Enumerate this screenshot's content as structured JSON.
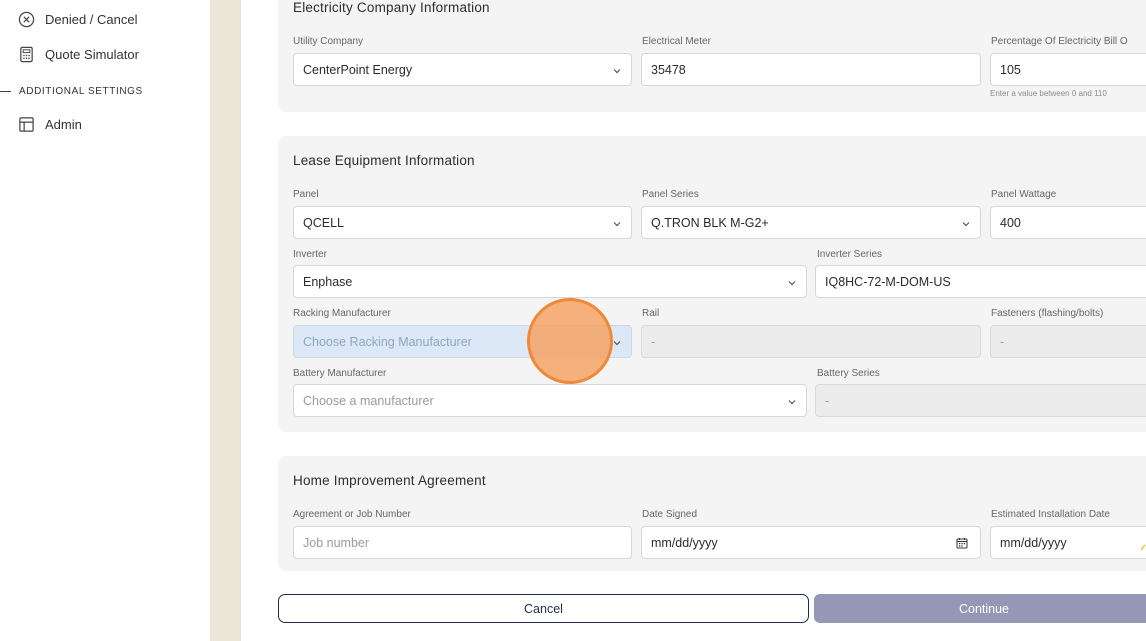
{
  "sidebar": {
    "items": [
      {
        "label": "Denied / Cancel",
        "icon": "circle-x-icon"
      },
      {
        "label": "Quote Simulator",
        "icon": "calculator-icon"
      }
    ],
    "section_label": "ADDITIONAL SETTINGS",
    "settings_items": [
      {
        "label": "Admin",
        "icon": "layout-icon"
      }
    ]
  },
  "electricity": {
    "title": "Electricity Company Information",
    "utility_company": {
      "label": "Utility Company",
      "value": "CenterPoint Energy"
    },
    "electrical_meter": {
      "label": "Electrical Meter",
      "value": "35478"
    },
    "bill_percentage": {
      "label": "Percentage Of Electricity Bill O",
      "value": "105",
      "hint": "Enter a value between 0 and 110"
    }
  },
  "lease": {
    "title": "Lease Equipment Information",
    "panel": {
      "label": "Panel",
      "value": "QCELL"
    },
    "panel_series": {
      "label": "Panel Series",
      "value": "Q.TRON BLK M-G2+"
    },
    "panel_wattage": {
      "label": "Panel Wattage",
      "value": "400"
    },
    "inverter": {
      "label": "Inverter",
      "value": "Enphase"
    },
    "inverter_series": {
      "label": "Inverter Series",
      "value": "IQ8HC-72-M-DOM-US"
    },
    "racking_manufacturer": {
      "label": "Racking Manufacturer",
      "placeholder": "Choose Racking Manufacturer"
    },
    "rail": {
      "label": "Rail",
      "value": "-"
    },
    "fasteners": {
      "label": "Fasteners (flashing/bolts)",
      "value": "-"
    },
    "battery_manufacturer": {
      "label": "Battery Manufacturer",
      "placeholder": "Choose a manufacturer"
    },
    "battery_series": {
      "label": "Battery Series",
      "value": "-"
    }
  },
  "agreement": {
    "title": "Home Improvement Agreement",
    "job_number": {
      "label": "Agreement or Job Number",
      "placeholder": "Job number"
    },
    "date_signed": {
      "label": "Date Signed",
      "value": "mm/dd/yyyy"
    },
    "install_date": {
      "label": "Estimated Installation Date",
      "value": "mm/dd/yyyy"
    }
  },
  "actions": {
    "cancel": "Cancel",
    "continue": "Continue"
  },
  "colors": {
    "primary_navy": "#1f2d4d",
    "continue_disabled": "#9498b6",
    "click_marker": "#ec8a3a"
  }
}
